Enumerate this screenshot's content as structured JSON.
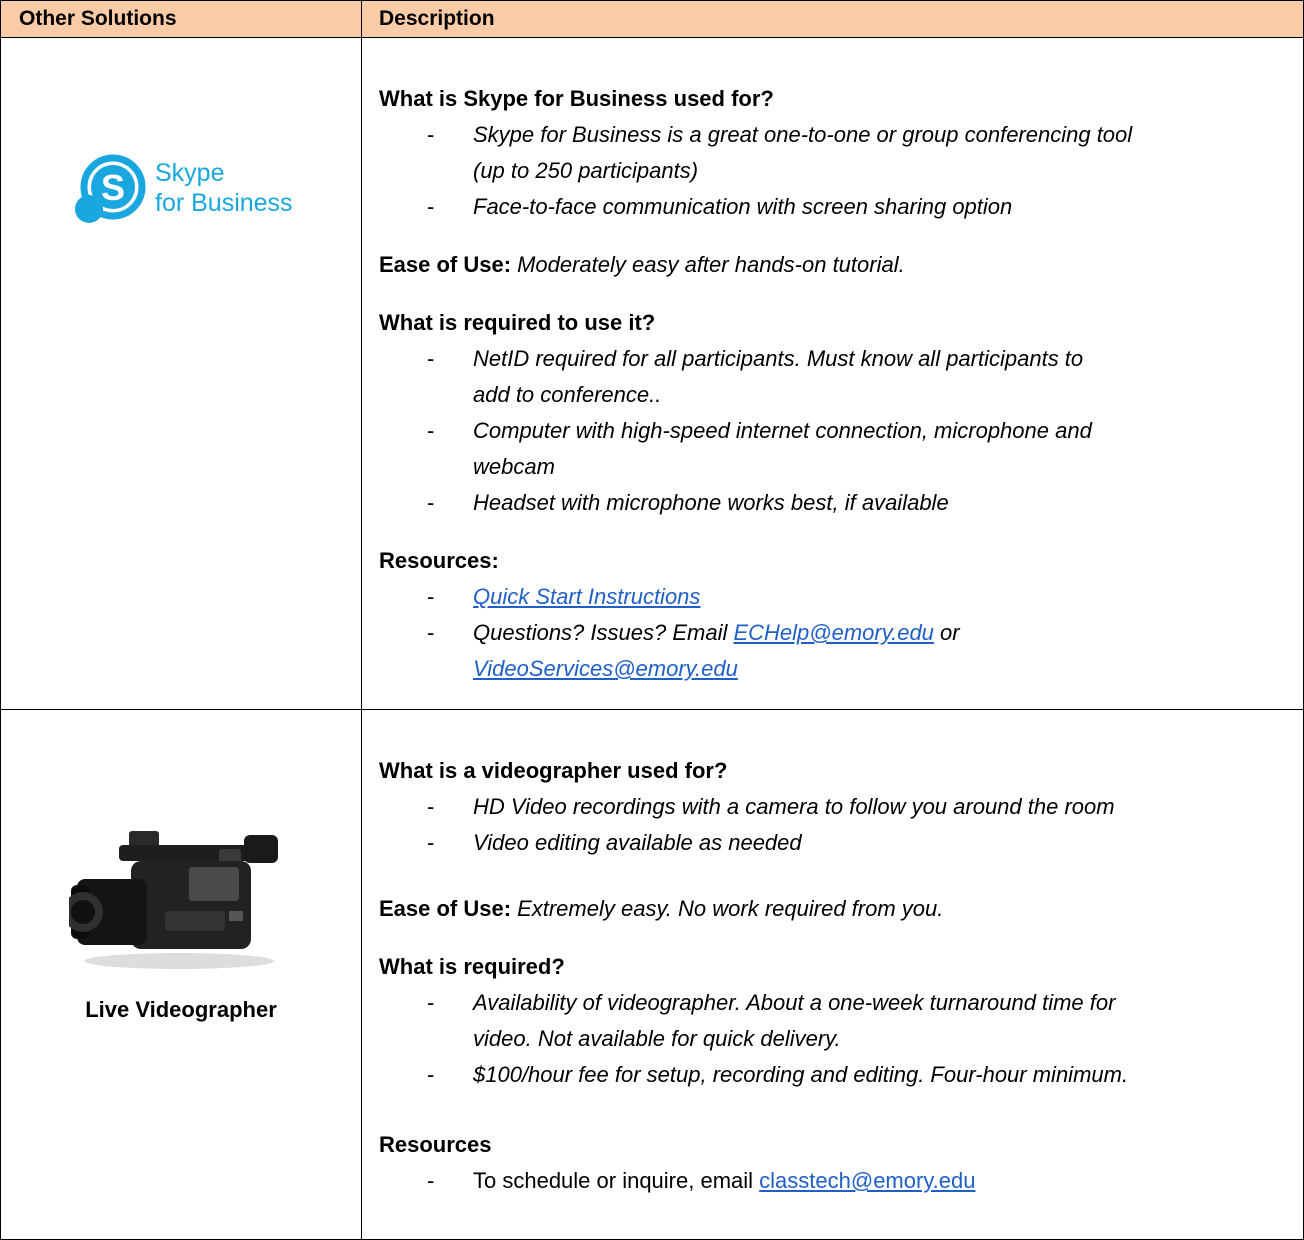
{
  "header": {
    "col1": "Other Solutions",
    "col2": "Description"
  },
  "row1": {
    "logo_text_1": "Skype",
    "logo_text_2": "for Business",
    "q1": "What is Skype for Business used for?",
    "used_for": [
      "Skype for Business is a great one-to-one or group conferencing tool",
      "(up to 250 participants)",
      "Face-to-face communication with screen sharing option"
    ],
    "ease_label": "Ease of Use:",
    "ease_value": "Moderately easy after hands-on tutorial.",
    "q2": "What is required to use it?",
    "required": [
      "NetID required for all participants.  Must know all participants to",
      "add to conference..",
      "Computer with high-speed internet connection, microphone and",
      "webcam",
      "Headset with microphone works best, if available"
    ],
    "resources_label": "Resources:",
    "resources": {
      "link1": "Quick Start Instructions",
      "questions_prefix": "Questions? Issues?  Email ",
      "email1": "ECHelp@emory.edu",
      "or": " or",
      "email2": "VideoServices@emory.edu"
    },
    "dash": "-"
  },
  "row2": {
    "label": "Live Videographer",
    "q1": "What is a videographer used for?",
    "used_for": [
      "HD Video recordings with a camera to follow you around the room",
      "Video editing available as needed"
    ],
    "ease_label": "Ease of Use:",
    "ease_value": "Extremely easy.  No work required from you.",
    "q2": "What is required?",
    "required": [
      "Availability of videographer.  About a one-week turnaround time for",
      "video.  Not available for quick delivery.",
      "$100/hour fee for setup, recording and editing.  Four-hour minimum."
    ],
    "resources_label": "Resources",
    "resources": {
      "prefix": "To schedule or inquire, email ",
      "email": "classtech@emory.edu"
    },
    "dash": "-"
  },
  "colors": {
    "header_bg": "#f9cba6",
    "skype_blue": "#1aa7e0",
    "link": "#1f5fc7"
  }
}
